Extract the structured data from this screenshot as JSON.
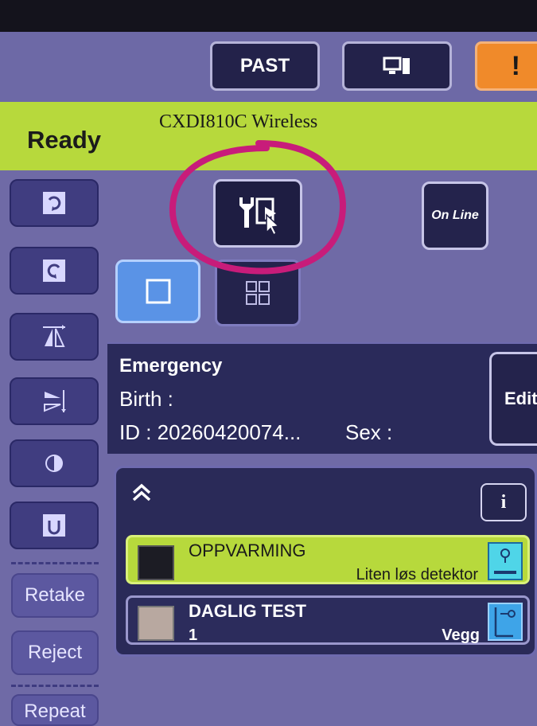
{
  "toolbar": {
    "past_label": "PAST",
    "computer_icon": "computer-icon",
    "warning_label": "!"
  },
  "status": {
    "state": "Ready",
    "device": "CXDI810C Wireless",
    "bar_color": "#b7d93c"
  },
  "left_buttons": {
    "retake": "Retake",
    "reject": "Reject",
    "repeat": "Repeat"
  },
  "main": {
    "online_label": "On Line",
    "tool_icon": "wrench-export-icon"
  },
  "patient": {
    "name": "Emergency",
    "birth": "Birth :",
    "id": "ID : 20260420074...",
    "sex": "Sex :",
    "edit_label": "Edit"
  },
  "exams": {
    "info_label": "i",
    "rows": [
      {
        "name": "OPPVARMING",
        "number": "",
        "detector": "Liten løs detektor",
        "swatch_color": "#1c1c24",
        "row_color": "#b7d93c",
        "icon_color": "#4fd5e8",
        "selected": true
      },
      {
        "name": "DAGLIG TEST",
        "number": "1",
        "detector": "Vegg",
        "swatch_color": "#b8a8a0",
        "row_color": "#2c2c5c",
        "icon_color": "#3ea4e8",
        "selected": false
      }
    ]
  },
  "colors": {
    "background": "#6f6aa6",
    "accent_green": "#b7d93c",
    "warning_orange": "#f08a2a",
    "highlight_circle": "#c81c7a"
  }
}
